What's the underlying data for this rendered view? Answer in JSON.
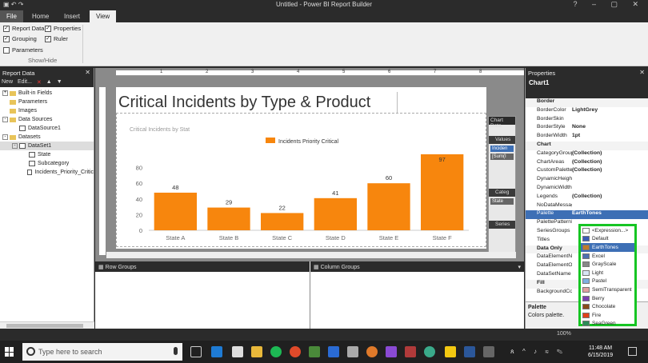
{
  "window": {
    "title": "Untitled - Power BI Report Builder"
  },
  "ribbon": {
    "tabs": [
      "File",
      "Home",
      "Insert",
      "View"
    ],
    "active_tab": "View",
    "checks": [
      {
        "label": "Report Data",
        "checked": true
      },
      {
        "label": "Properties",
        "checked": true
      },
      {
        "label": "Grouping",
        "checked": true
      },
      {
        "label": "Ruler",
        "checked": true
      },
      {
        "label": "Parameters",
        "checked": false
      }
    ],
    "group_label": "Show/Hide"
  },
  "report_data": {
    "title": "Report Data",
    "toolbar": {
      "new": "New",
      "edit": "Edit..."
    },
    "tree": [
      {
        "label": "Built-in Fields",
        "level": 0,
        "kind": "folder",
        "exp": "+"
      },
      {
        "label": "Parameters",
        "level": 0,
        "kind": "folder",
        "exp": ""
      },
      {
        "label": "Images",
        "level": 0,
        "kind": "folder",
        "exp": ""
      },
      {
        "label": "Data Sources",
        "level": 0,
        "kind": "folder",
        "exp": "-"
      },
      {
        "label": "DataSource1",
        "level": 1,
        "kind": "doc",
        "exp": ""
      },
      {
        "label": "Datasets",
        "level": 0,
        "kind": "folder",
        "exp": "-"
      },
      {
        "label": "DataSet1",
        "level": 1,
        "kind": "doc",
        "exp": "-"
      },
      {
        "label": "State",
        "level": 2,
        "kind": "doc",
        "exp": ""
      },
      {
        "label": "Subcategory",
        "level": 2,
        "kind": "doc",
        "exp": ""
      },
      {
        "label": "Incidents_Priority_Critic",
        "level": 2,
        "kind": "doc",
        "exp": ""
      }
    ]
  },
  "report": {
    "title": "Critical Incidents by Type & Product",
    "ruler_numbers": [
      "1",
      "2",
      "3",
      "4",
      "5",
      "6",
      "7",
      "8"
    ]
  },
  "chart_data": {
    "type": "bar",
    "title": "Critical Incidents by Stat",
    "categories": [
      "State A",
      "State B",
      "State C",
      "State D",
      "State E",
      "State F"
    ],
    "series": [
      {
        "name": "Incidents Priority Critical",
        "values": [
          48,
          29,
          22,
          41,
          60,
          97
        ]
      }
    ],
    "ylim": [
      0,
      100
    ],
    "yticks": [
      0,
      20,
      40,
      60,
      80
    ],
    "bar_color": "#f7860d",
    "grid": false,
    "legend": "top-center"
  },
  "chart_data_panel": {
    "title": "Chart Data",
    "values_label": "Values",
    "value_item": "Inciden",
    "value_sub": "[Sum(I",
    "category_label": "Categ",
    "category_item": "State",
    "series_label": "Series"
  },
  "grouping": {
    "row_groups": "Row Groups",
    "column_groups": "Column Groups"
  },
  "properties": {
    "title": "Properties",
    "object": "Chart1",
    "rows": [
      {
        "name": "Border",
        "value": "",
        "cat": true
      },
      {
        "name": "BorderColor",
        "value": "LightGrey"
      },
      {
        "name": "BorderSkin",
        "value": ""
      },
      {
        "name": "BorderStyle",
        "value": "None"
      },
      {
        "name": "BorderWidth",
        "value": "1pt"
      },
      {
        "name": "Chart",
        "value": "",
        "cat": true
      },
      {
        "name": "CategoryGroups",
        "value": "(Collection)"
      },
      {
        "name": "ChartAreas",
        "value": "(Collection)"
      },
      {
        "name": "CustomPaletteCo",
        "value": "(Collection)"
      },
      {
        "name": "DynamicHeight",
        "value": ""
      },
      {
        "name": "DynamicWidth",
        "value": ""
      },
      {
        "name": "Legends",
        "value": "(Collection)"
      },
      {
        "name": "NoDataMessage",
        "value": ""
      },
      {
        "name": "Palette",
        "value": "EarthTones",
        "sel": true
      },
      {
        "name": "PalettePatternBe",
        "value": ""
      },
      {
        "name": "SeriesGroups",
        "value": ""
      },
      {
        "name": "Titles",
        "value": ""
      },
      {
        "name": "Data Only",
        "value": "",
        "cat": true
      },
      {
        "name": "DataElementNam",
        "value": ""
      },
      {
        "name": "DataElementOut",
        "value": ""
      },
      {
        "name": "DataSetName",
        "value": ""
      },
      {
        "name": "Fill",
        "value": "",
        "cat": true
      },
      {
        "name": "BackgroundColo",
        "value": ""
      }
    ],
    "desc_title": "Palette",
    "desc_text": "Colors palette."
  },
  "palette_options": [
    {
      "label": "<Expression...>",
      "color": "#ffffff"
    },
    {
      "label": "Default",
      "color": "#3b5bb5"
    },
    {
      "label": "EarthTones",
      "color": "#c07b2a",
      "sel": true
    },
    {
      "label": "Excel",
      "color": "#4f6fb0"
    },
    {
      "label": "GrayScale",
      "color": "#888888"
    },
    {
      "label": "Light",
      "color": "#d8e4f4"
    },
    {
      "label": "Pastel",
      "color": "#7fb0e0"
    },
    {
      "label": "SemiTransparent",
      "color": "#e0a0a0"
    },
    {
      "label": "Berry",
      "color": "#7a3fb0"
    },
    {
      "label": "Chocolate",
      "color": "#8a4a1a"
    },
    {
      "label": "Fire",
      "color": "#e0401a"
    },
    {
      "label": "SeaGreen",
      "color": "#2e8b57"
    }
  ],
  "status": {
    "zoom": "100%"
  },
  "taskbar": {
    "search_placeholder": "Type here to search",
    "time": "11:48 AM",
    "date": "6/15/2019"
  }
}
